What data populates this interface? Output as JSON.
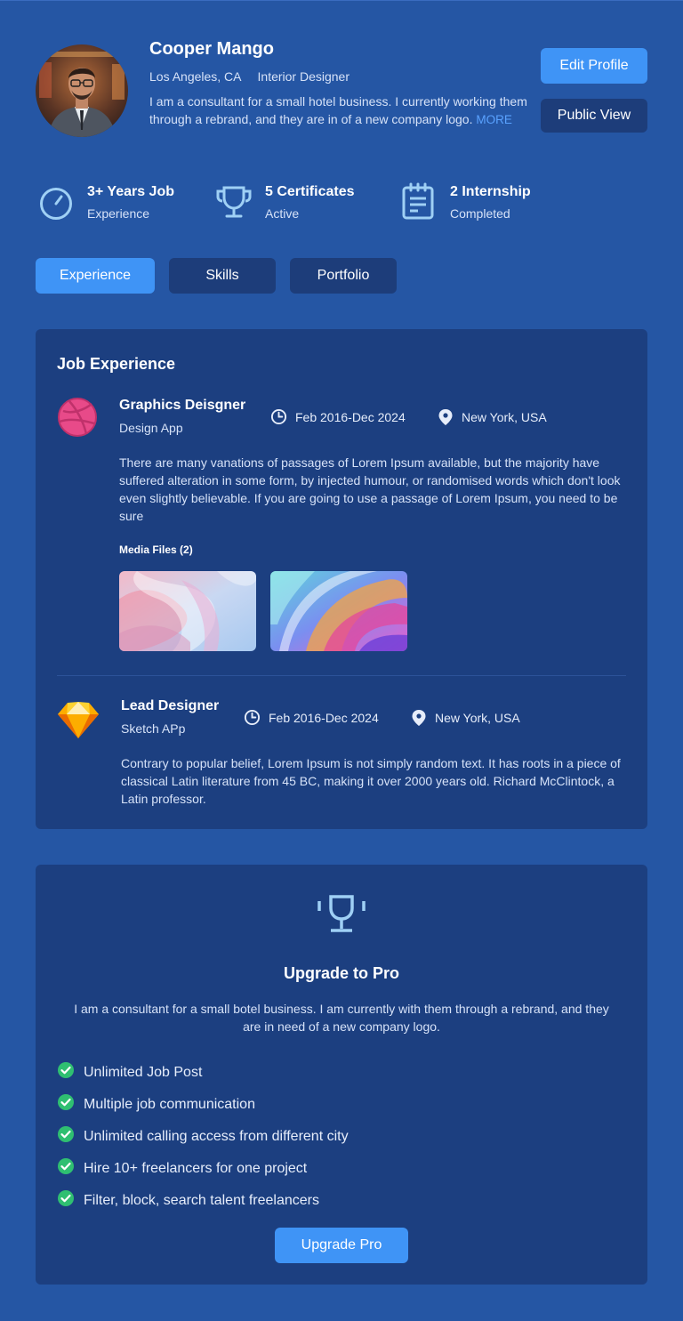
{
  "profile": {
    "name": "Cooper Mango",
    "location": "Los Angeles, CA",
    "title": "Interior Designer",
    "bio": "I am a consultant for a small hotel business. I currently working them through a rebrand, and they are in of a new company logo.",
    "more_link": "MORE",
    "edit_button": "Edit Profile",
    "public_button": "Public View"
  },
  "stats": [
    {
      "title": "3+ Years Job",
      "subtitle": "Experience",
      "icon": "stopwatch-icon"
    },
    {
      "title": "5 Certificates",
      "subtitle": "Active",
      "icon": "trophy-icon"
    },
    {
      "title": "2 Internship",
      "subtitle": "Completed",
      "icon": "notepad-icon"
    }
  ],
  "tabs": [
    {
      "label": "Experience",
      "active": true
    },
    {
      "label": "Skills",
      "active": false
    },
    {
      "label": "Portfolio",
      "active": false
    }
  ],
  "experience": {
    "heading": "Job Experience",
    "jobs": [
      {
        "role": "Graphics Deisgner",
        "company": "Design App",
        "date": "Feb 2016-Dec 2024",
        "location": "New York, USA",
        "logo": "dribbble-icon",
        "description": "There are many vanations of passages of Lorem Ipsum available, but the majority have suffered alteration in some form, by injected humour, or randomised words which don't look even slightly believable. If you are going to use a passage of Lorem Ipsum, you need to be sure",
        "media_label": "Media Files (2)"
      },
      {
        "role": "Lead Designer",
        "company": "Sketch APp",
        "date": "Feb 2016-Dec 2024",
        "location": "New York, USA",
        "logo": "sketch-icon",
        "description": "Contrary to popular belief, Lorem Ipsum is not simply random text. It has roots in a piece of classical Latin literature from 45 BC, making it over 2000 years old. Richard McClintock, a Latin professor."
      }
    ]
  },
  "pro": {
    "title": "Upgrade to Pro",
    "description": "I am a consultant for a small botel business. I am currently with them through a rebrand, and they are in need of a new company logo.",
    "features": [
      "Unlimited Job Post",
      "Multiple job communication",
      "Unlimited calling access from different city",
      "Hire 10+ freelancers for one project",
      "Filter, block, search talent freelancers"
    ],
    "button": "Upgrade Pro"
  },
  "colors": {
    "background": "#2556a4",
    "card": "#1c3f80",
    "accent": "#3f94f6",
    "dark_button": "#1d3d7a",
    "check": "#2fbf71"
  }
}
